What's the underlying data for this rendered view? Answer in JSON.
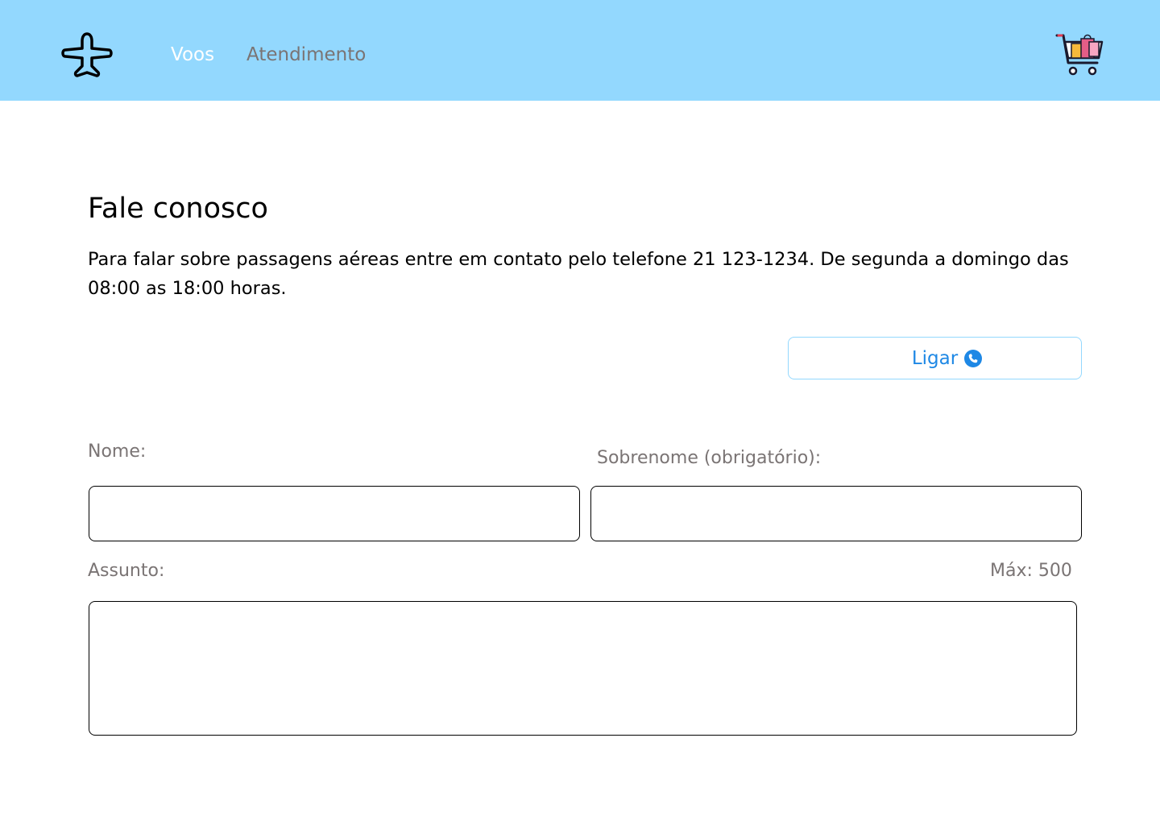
{
  "header": {
    "logo_icon": "airplane-icon",
    "nav": {
      "voos": "Voos",
      "atendimento": "Atendimento"
    },
    "cart_icon": "shopping-cart-icon",
    "background_color": "#93d8fe",
    "active_nav_color": "#ffffff",
    "inactive_nav_color": "#7a7474"
  },
  "main": {
    "title": "Fale conosco",
    "intro": "Para falar sobre passagens aéreas entre em contato pelo telefone 21 123-1234. De segunda a domingo das 08:00 as 18:00 horas.",
    "call_button": {
      "label": "Ligar",
      "icon": "phone-icon",
      "color": "#1e88e5"
    },
    "form": {
      "nome_label": "Nome:",
      "nome_value": "",
      "sobrenome_label": "Sobrenome (obrigatório):",
      "sobrenome_value": "",
      "assunto_label": "Assunto:",
      "assunto_value": "",
      "max_label": "Máx: 500"
    }
  }
}
